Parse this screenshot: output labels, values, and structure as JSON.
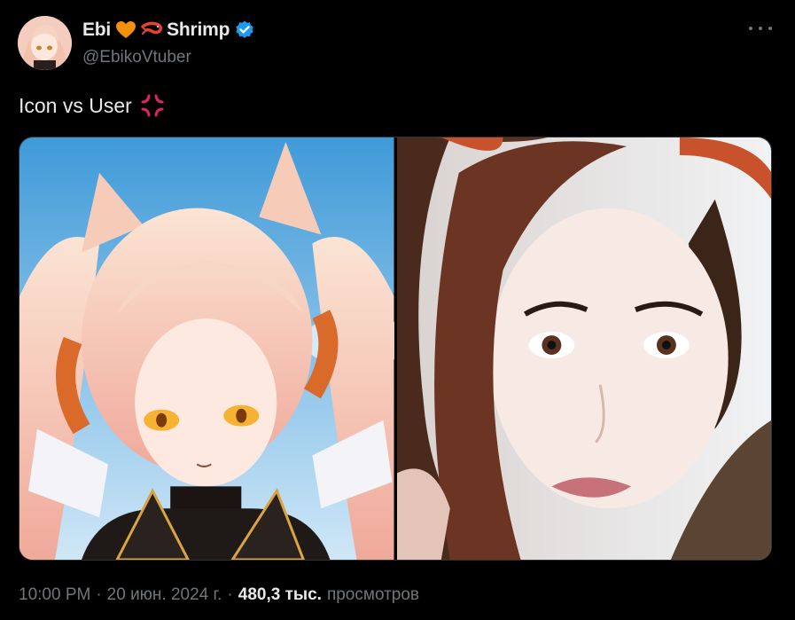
{
  "author": {
    "name_part1": "Ebi",
    "name_part2": "Shrimp",
    "handle": "@EbikoVtuber",
    "icons": [
      "orange-heart-icon",
      "shrimp-icon",
      "verified-badge-icon"
    ],
    "verified_color": "#1d9bf0"
  },
  "tweet": {
    "text": "Icon vs User",
    "emoji": "anger-symbol-icon",
    "media": [
      {
        "name": "anime-avatar-image"
      },
      {
        "name": "user-photo-image"
      }
    ]
  },
  "meta": {
    "time": "10:00 PM",
    "sep1": "·",
    "date": "20 июн. 2024 г.",
    "sep2": "·",
    "views_count": "480,3 тыс.",
    "views_label": "просмотров"
  },
  "colors": {
    "background": "#000000",
    "text_primary": "#e7e9ea",
    "text_secondary": "#71767b"
  }
}
